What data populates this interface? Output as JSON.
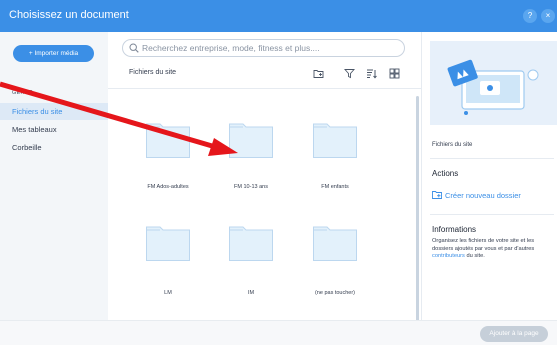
{
  "window": {
    "title": "Choisissez un document",
    "help_label": "?",
    "close_label": "×"
  },
  "sidebar": {
    "import_label": "+ Importer média",
    "section_label": "GÉRER",
    "items": [
      {
        "label": "Fichiers du site",
        "active": true
      },
      {
        "label": "Mes tableaux",
        "active": false
      },
      {
        "label": "Corbeille",
        "active": false
      }
    ]
  },
  "search": {
    "placeholder": "Recherchez entreprise, mode, fitness et plus...."
  },
  "main": {
    "path_title": "Fichiers du site",
    "toolbar_icons": [
      "new-folder-icon",
      "filter-icon",
      "sort-icon",
      "grid-view-icon"
    ],
    "folders": [
      {
        "label": "FM Ados-adultes"
      },
      {
        "label": "FM 10-13 ans"
      },
      {
        "label": "FM enfants"
      },
      {
        "label": "LM"
      },
      {
        "label": "IM"
      },
      {
        "label": "(ne pas toucher)"
      }
    ]
  },
  "right_panel": {
    "title": "Fichiers du site",
    "actions_title": "Actions",
    "create_folder_label": "Créer nouveau dossier",
    "info_title": "Informations",
    "info_text_1": "Organisez les fichiers de votre site et les dossiers ajoutés par vous et par d'autres",
    "info_link": "contributeurs",
    "info_text_2": "du site."
  },
  "footer": {
    "add_label": "Ajouter à la page"
  },
  "colors": {
    "accent": "#3b8fe6",
    "folder_fill": "#e3f1fb",
    "folder_stroke": "#bcd7ef",
    "annotation_arrow": "#e5161b",
    "disabled_button": "#c6cfd9"
  }
}
